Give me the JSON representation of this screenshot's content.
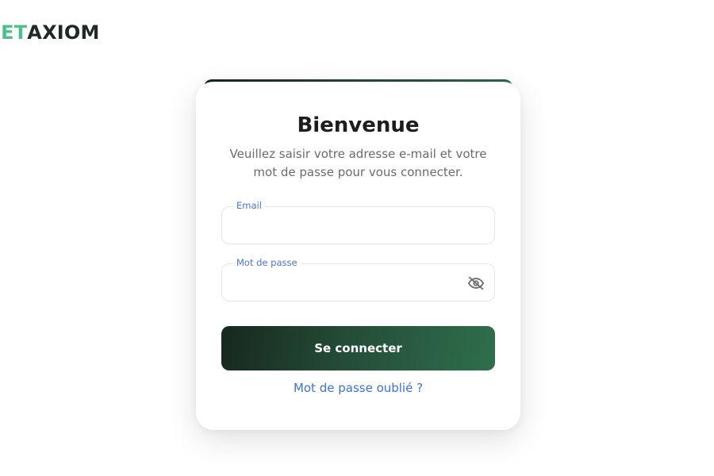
{
  "logo": {
    "part_a": "IET",
    "part_b": "AXIOM",
    "colors": {
      "accent": "#4cc08a",
      "dark": "#1f2a26"
    }
  },
  "login": {
    "title": "Bienvenue",
    "subtitle": "Veuillez saisir votre adresse e-mail et votre mot de passe pour vous connecter.",
    "email": {
      "label": "Email",
      "value": ""
    },
    "password": {
      "label": "Mot de passe",
      "value": "",
      "toggle_icon": "eye-off-icon"
    },
    "submit_label": "Se connecter",
    "forgot_label": "Mot de passe oublié ?"
  },
  "colors": {
    "button_gradient_start": "#17281f",
    "button_gradient_end": "#2f6f4d",
    "label_blue": "#4d73d6",
    "link_blue": "#3a73d1"
  }
}
